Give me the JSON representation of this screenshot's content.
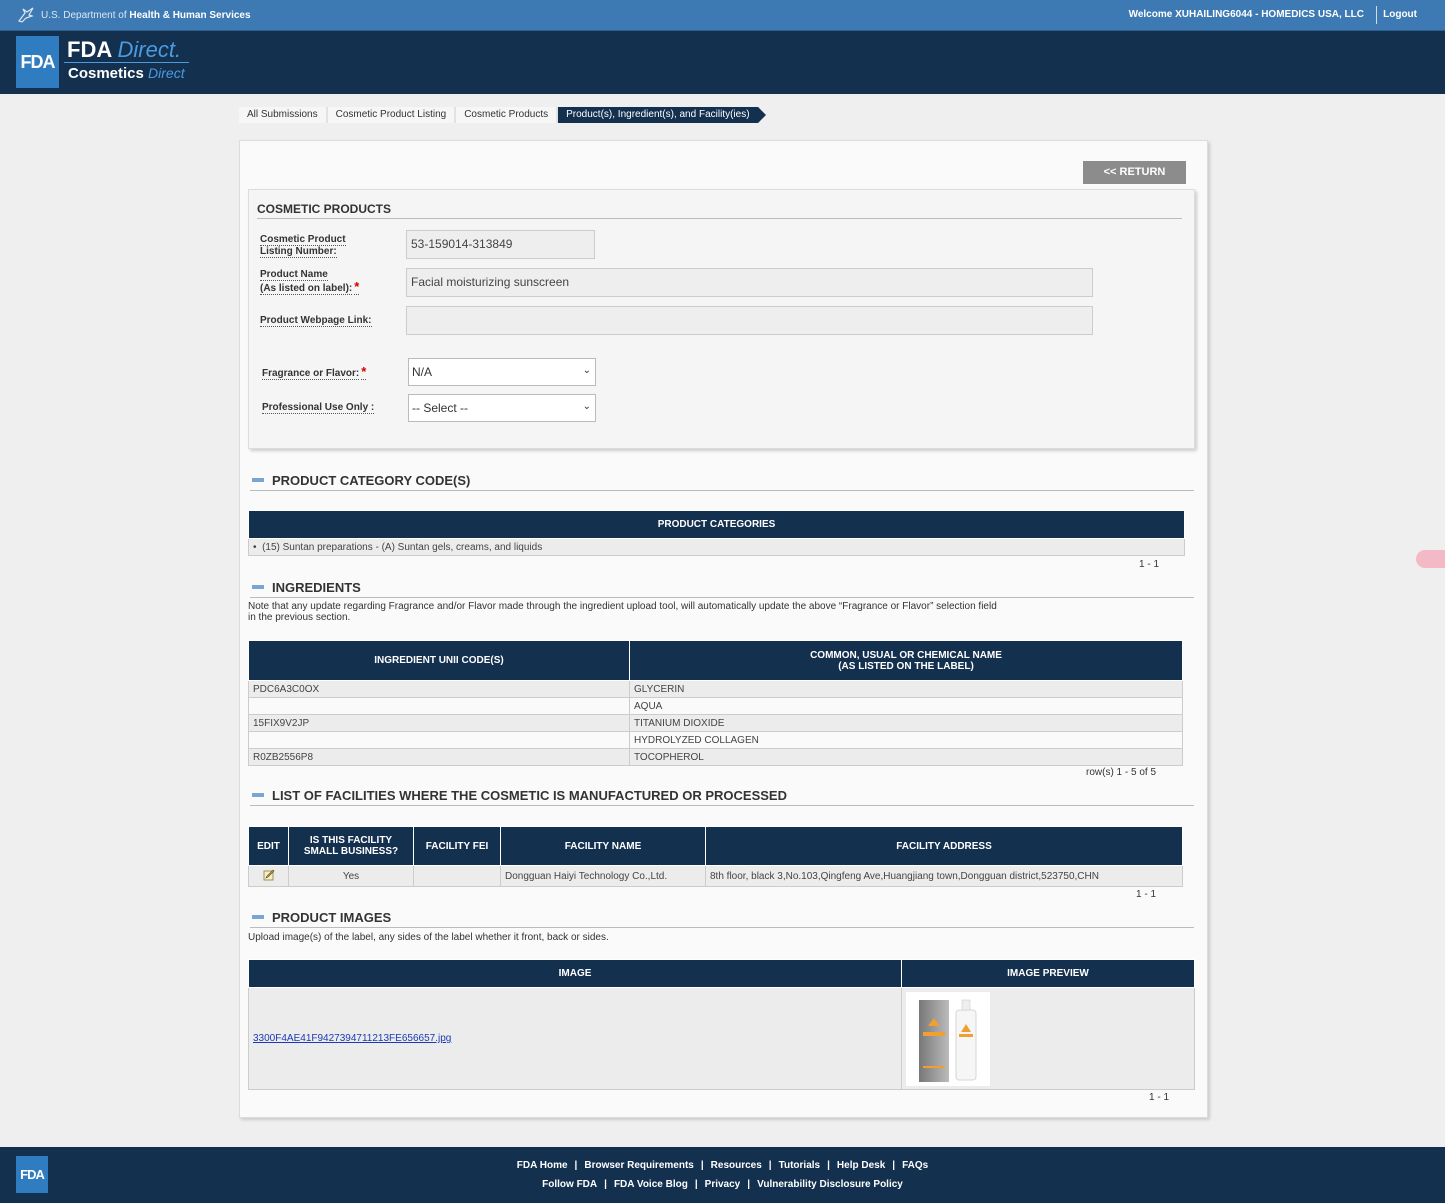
{
  "topbar": {
    "agency_prefix": "U.S. Department of",
    "agency_name": "Health & Human Services",
    "welcome": "Welcome XUHAILING6044 - HOMEDICS USA, LLC",
    "logout": "Logout"
  },
  "header": {
    "logo": "FDA",
    "brand_line1_bold": "FDA",
    "brand_line1_italic": "Direct.",
    "brand_line2_bold": "Cosmetics",
    "brand_line2_italic": "Direct"
  },
  "breadcrumb": [
    "All Submissions",
    "Cosmetic Product Listing",
    "Cosmetic Products",
    "Product(s), Ingredient(s), and Facility(ies)"
  ],
  "return_button": "<< RETURN",
  "product_form": {
    "title": "COSMETIC PRODUCTS",
    "listing_number_label_1": "Cosmetic Product",
    "listing_number_label_2": "Listing Number:",
    "listing_number_value": "53-159014-313849",
    "product_name_label_1": "Product Name",
    "product_name_label_2": "(As listed on label):",
    "product_name_value": "Facial moisturizing sunscreen",
    "webpage_label": "Product Webpage Link:",
    "webpage_value": "",
    "fragrance_label": "Fragrance or Flavor:",
    "fragrance_value": "N/A",
    "professional_label": "Professional Use Only :",
    "professional_value": "-- Select --",
    "required_mark": "*"
  },
  "category_section": {
    "title": "PRODUCT CATEGORY CODE(S)",
    "column": "PRODUCT CATEGORIES",
    "items": [
      "(15) Suntan preparations - (A) Suntan gels, creams, and liquids"
    ],
    "pager": "1 - 1"
  },
  "ingredients_section": {
    "title": "INGREDIENTS",
    "note_line1": "Note that any update regarding Fragrance and/or Flavor made through the ingredient upload tool, will automatically update the above “Fragrance or Flavor” selection field",
    "note_line2": "in the previous section.",
    "col_unii": "INGREDIENT UNII CODE(S)",
    "col_name_1": "COMMON, USUAL OR CHEMICAL NAME",
    "col_name_2": "(AS LISTED ON THE LABEL)",
    "rows": [
      {
        "unii": "PDC6A3C0OX",
        "name": "GLYCERIN"
      },
      {
        "unii": "",
        "name": "AQUA"
      },
      {
        "unii": "15FIX9V2JP",
        "name": "TITANIUM DIOXIDE"
      },
      {
        "unii": "",
        "name": "HYDROLYZED COLLAGEN"
      },
      {
        "unii": "R0ZB2556P8",
        "name": "TOCOPHEROL"
      }
    ],
    "pager": "row(s) 1 - 5 of 5"
  },
  "facilities_section": {
    "title": "LIST OF FACILITIES WHERE THE COSMETIC IS MANUFACTURED OR PROCESSED",
    "col_edit": "EDIT",
    "col_small_1": "IS THIS FACILITY",
    "col_small_2": "SMALL BUSINESS?",
    "col_fei": "FACILITY FEI",
    "col_name": "FACILITY NAME",
    "col_address": "FACILITY ADDRESS",
    "rows": [
      {
        "small_business": "Yes",
        "fei": "",
        "name": "Dongguan Haiyi Technology Co.,Ltd.",
        "address": "8th floor, black 3,No.103,Qingfeng Ave,Huangjiang town,Dongguan district,523750,CHN"
      }
    ],
    "pager": "1 - 1"
  },
  "images_section": {
    "title": "PRODUCT IMAGES",
    "note": "Upload image(s) of the label, any sides of the label whether it front, back or sides.",
    "col_image": "IMAGE",
    "col_preview": "IMAGE PREVIEW",
    "rows": [
      {
        "file": "3300F4AE41F9427394711213FE656657.jpg"
      }
    ],
    "pager": "1 - 1"
  },
  "footer": {
    "logo": "FDA",
    "row1": [
      "FDA Home",
      "Browser Requirements",
      "Resources",
      "Tutorials",
      "Help Desk",
      "FAQs"
    ],
    "row2": [
      "Follow FDA",
      "FDA Voice Blog",
      "Privacy",
      "Vulnerability Disclosure Policy"
    ],
    "separator": "|"
  },
  "colors": {
    "navy": "#14304f",
    "topbar_blue": "#3d79b3",
    "fda_blue": "#2f7dc0",
    "required_red": "#cc0000",
    "link_blue": "#1a3bb5"
  }
}
